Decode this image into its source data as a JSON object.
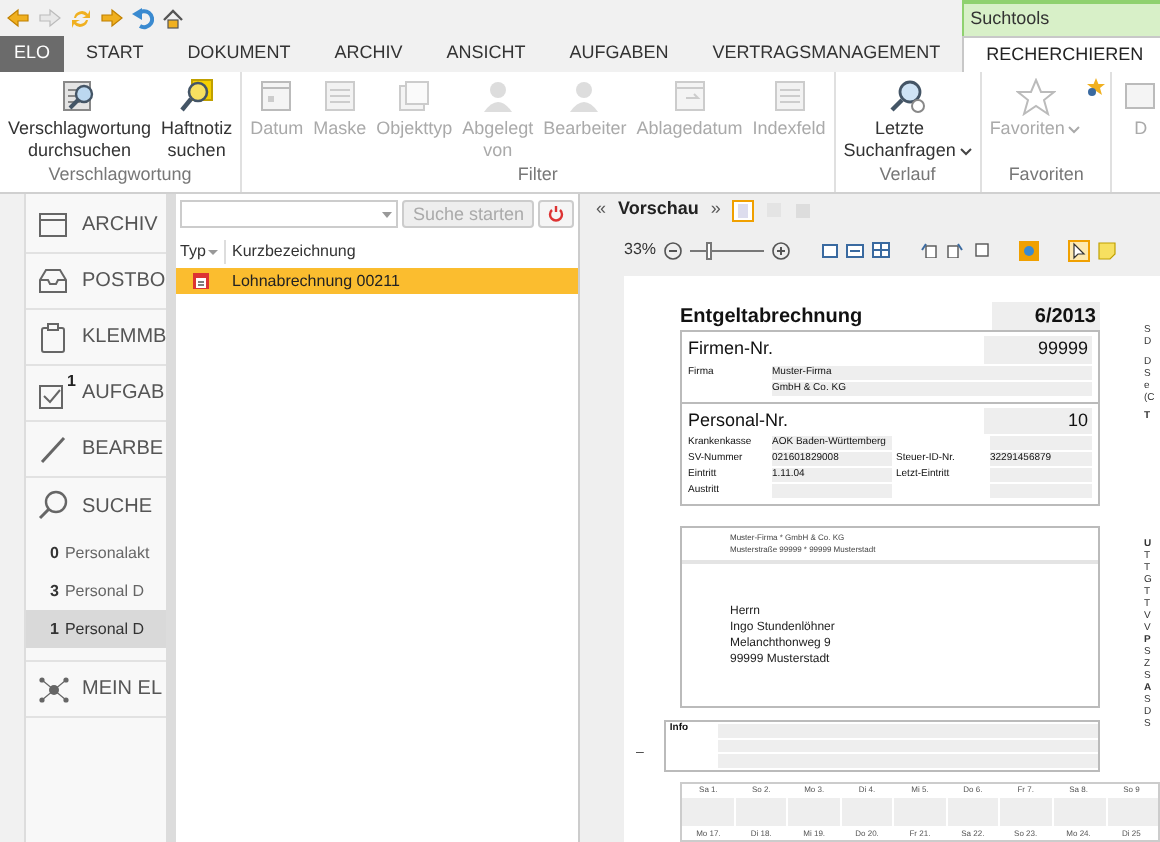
{
  "app_menu": "ELO",
  "tabs": [
    {
      "label": "START",
      "selected": false
    },
    {
      "label": "DOKUMENT",
      "selected": false
    },
    {
      "label": "ARCHIV",
      "selected": false
    },
    {
      "label": "ANSICHT",
      "selected": false
    },
    {
      "label": "AUFGABEN",
      "selected": false
    },
    {
      "label": "VERTRAGSMANAGEMENT",
      "selected": false
    }
  ],
  "context_tab_group": {
    "label": "Suchtools",
    "tabs": [
      {
        "label": "RECHERCHIEREN",
        "selected": true
      }
    ]
  },
  "ribbon": [
    {
      "label": "Verschlagwortung",
      "buttons": [
        {
          "label": "Verschlagwortung durchsuchen",
          "disabled": false,
          "menu": false
        },
        {
          "label": "Haftnotiz suchen",
          "disabled": false,
          "menu": false
        }
      ]
    },
    {
      "label": "Filter",
      "buttons": [
        {
          "label": "Datum",
          "disabled": true,
          "menu": false
        },
        {
          "label": "Maske",
          "disabled": true,
          "menu": false
        },
        {
          "label": "Objekttyp",
          "disabled": true,
          "menu": false
        },
        {
          "label": "Abgelegt von",
          "disabled": true,
          "menu": false
        },
        {
          "label": "Bearbeiter",
          "disabled": true,
          "menu": false
        },
        {
          "label": "Ablagedatum",
          "disabled": true,
          "menu": false
        },
        {
          "label": "Indexfeld",
          "disabled": true,
          "menu": false
        }
      ]
    },
    {
      "label": "Verlauf",
      "buttons": [
        {
          "label": "Letzte Suchanfragen",
          "disabled": false,
          "menu": true
        }
      ]
    },
    {
      "label": "Favoriten",
      "buttons": [
        {
          "label": "Favoriten",
          "disabled": true,
          "menu": true
        }
      ]
    },
    {
      "buttons": [
        {
          "label": "D",
          "disabled": true,
          "menu": false
        }
      ]
    }
  ],
  "sidebar": [
    {
      "label": "ARCHIV"
    },
    {
      "label": "POSTBO"
    },
    {
      "label": "KLEMMB"
    },
    {
      "label": "AUFGAB",
      "badge": "1"
    },
    {
      "label": "BEARBE"
    },
    {
      "label": "SUCHE",
      "children": [
        {
          "count": "0",
          "label": "Personalakt",
          "selected": false
        },
        {
          "count": "3",
          "label": "Personal D",
          "selected": false
        },
        {
          "count": "1",
          "label": "Personal D",
          "selected": true
        }
      ]
    },
    {
      "label": "MEIN EL"
    }
  ],
  "results": {
    "search_button": {
      "label": "Suche starten",
      "disabled": true
    },
    "columns": [
      "Typ",
      "Kurzbezeichnung"
    ],
    "rows": [
      {
        "name": "Lohnabrechnung 00211",
        "selected": true
      }
    ]
  },
  "preview": {
    "prev": "«",
    "title": "Vorschau",
    "next": "»",
    "zoom": "33%",
    "level": 0.2,
    "document": {
      "title": "Entgeltabrechnung",
      "period": "6/2013",
      "firm": {
        "label": "Firmen-Nr.",
        "value": "99999",
        "rows": [
          [
            "Firma",
            "Muster-Firma"
          ],
          [
            "",
            "GmbH & Co. KG"
          ]
        ]
      },
      "person": {
        "label": "Personal-Nr.",
        "value": "10",
        "rows": [
          [
            "Krankenkasse",
            "AOK Baden-Württemberg",
            "",
            ""
          ],
          [
            "SV-Nummer",
            "021601829008",
            "Steuer-ID-Nr.",
            "32291456879"
          ],
          [
            "Eintritt",
            "1.11.04",
            "Letzt-Eintritt",
            ""
          ],
          [
            "Austritt",
            "",
            "",
            ""
          ]
        ]
      },
      "sender": [
        "Muster-Firma * GmbH & Co. KG",
        "Musterstraße 99999 * 99999 Musterstadt"
      ],
      "recipient": [
        "Herrn",
        "Ingo Stundenlöhner",
        "Melanchthonweg 9",
        "99999 Musterstadt"
      ],
      "info": "Info",
      "dash": "–",
      "calendar": [
        [
          "Sa 1.",
          "So 2.",
          "Mo 3.",
          "Di 4.",
          "Mi 5.",
          "Do 6.",
          "Fr 7.",
          "Sa 8.",
          "So 9"
        ],
        [
          "Mo 17.",
          "Di 18.",
          "Mi 19.",
          "Do 20.",
          "Fr 21.",
          "Sa 22.",
          "So 23.",
          "Mo 24.",
          "Di 25"
        ]
      ],
      "side_top": [
        {
          "text": "S",
          "heading": false
        },
        {
          "text": "D",
          "heading": false
        },
        {
          "text": "D",
          "heading": false
        },
        {
          "text": "S",
          "heading": false
        },
        {
          "text": "e",
          "heading": false
        },
        {
          "text": "(C",
          "heading": false
        },
        {
          "text": "T",
          "heading": true
        }
      ],
      "side_bottom": [
        {
          "text": "U",
          "heading": true
        },
        {
          "text": "T",
          "heading": false
        },
        {
          "text": "T",
          "heading": false
        },
        {
          "text": "G",
          "heading": false
        },
        {
          "text": "T",
          "heading": false
        },
        {
          "text": "T",
          "heading": false
        },
        {
          "text": "V",
          "heading": false
        },
        {
          "text": "V",
          "heading": false
        },
        {
          "text": "P",
          "heading": true
        },
        {
          "text": "S",
          "heading": false
        },
        {
          "text": "Z",
          "heading": false
        },
        {
          "text": "S",
          "heading": false
        },
        {
          "text": "A",
          "heading": true
        },
        {
          "text": "S",
          "heading": false
        },
        {
          "text": "D",
          "heading": false
        },
        {
          "text": "S",
          "heading": false
        }
      ]
    }
  }
}
